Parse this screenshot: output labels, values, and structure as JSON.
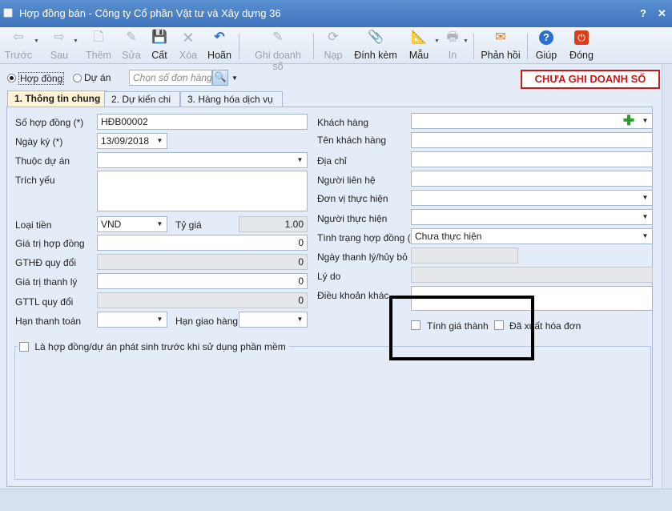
{
  "window": {
    "title": "Hợp đồng bán - Công ty Cổ phần Vật tư và Xây dựng 36",
    "help": "?",
    "close": "✕"
  },
  "toolbar": [
    {
      "label": "Trước",
      "icon": "arrow-left-icon",
      "glyph": "⇦",
      "enabled": false
    },
    {
      "label": "Sau",
      "icon": "arrow-right-icon",
      "glyph": "⇨",
      "enabled": false
    },
    {
      "label": "Thêm",
      "icon": "new-doc-icon",
      "glyph": "🗋",
      "enabled": false
    },
    {
      "label": "Sửa",
      "icon": "edit-doc-icon",
      "glyph": "✎",
      "enabled": false
    },
    {
      "label": "Cất",
      "icon": "save-icon",
      "glyph": "💾",
      "enabled": true
    },
    {
      "label": "Xóa",
      "icon": "delete-doc-icon",
      "glyph": "🗙",
      "enabled": false
    },
    {
      "label": "Hoãn",
      "icon": "undo-icon",
      "glyph": "↶",
      "enabled": true
    },
    {
      "label": "Ghi doanh số",
      "icon": "pencil-icon",
      "glyph": "✎",
      "enabled": false
    },
    {
      "label": "Nạp",
      "icon": "reload-icon",
      "glyph": "⟳",
      "enabled": false
    },
    {
      "label": "Đính kèm",
      "icon": "paperclip-icon",
      "glyph": "📎",
      "enabled": true
    },
    {
      "label": "Mẫu",
      "icon": "template-icon",
      "glyph": "📐",
      "enabled": true
    },
    {
      "label": "In",
      "icon": "print-icon",
      "glyph": "🖶",
      "enabled": false
    },
    {
      "label": "Phản hồi",
      "icon": "mail-icon",
      "glyph": "✉",
      "enabled": true
    },
    {
      "label": "Giúp",
      "icon": "help-icon",
      "glyph": "?",
      "enabled": true
    },
    {
      "label": "Đóng",
      "icon": "close-icon",
      "glyph": "⏻",
      "enabled": true
    }
  ],
  "mode": {
    "contract": "Hợp đồng",
    "project": "Dự án",
    "search_placeholder": "Chọn số đơn hàng"
  },
  "status_badge": "CHƯA GHI DOANH SỐ",
  "tabs": [
    "1. Thông tin chung",
    "2. Dự kiến chi",
    "3. Hàng hóa dịch vụ"
  ],
  "left": {
    "so_hop_dong": {
      "label": "Số hợp đồng (*)",
      "value": "HĐB00002"
    },
    "ngay_ky": {
      "label": "Ngày ký (*)",
      "value": "13/09/2018"
    },
    "thuoc_du_an": {
      "label": "Thuộc dự án",
      "value": ""
    },
    "trich_yeu": {
      "label": "Trích yếu",
      "value": ""
    },
    "loai_tien": {
      "label": "Loại tiền",
      "value": "VND"
    },
    "ty_gia": {
      "label": "Tỷ giá",
      "value": "1.00"
    },
    "gia_tri_hd": {
      "label": "Giá trị hợp đồng",
      "value": "0"
    },
    "gthd_quy_doi": {
      "label": "GTHĐ quy đổi",
      "value": "0"
    },
    "gia_tri_tl": {
      "label": "Giá trị thanh lý",
      "value": "0"
    },
    "gttl_quy_doi": {
      "label": "GTTL quy đổi",
      "value": "0"
    },
    "han_thanh_toan": {
      "label": "Hạn thanh toán",
      "value": ""
    },
    "han_giao_hang": {
      "label": "Hạn giao hàng",
      "value": ""
    }
  },
  "right": {
    "khach_hang": {
      "label": "Khách hàng",
      "value": ""
    },
    "ten_khach_hang": {
      "label": "Tên khách hàng",
      "value": ""
    },
    "dia_chi": {
      "label": "Địa chỉ",
      "value": ""
    },
    "nguoi_lien_he": {
      "label": "Người liên hệ",
      "value": ""
    },
    "don_vi_thuc_hien": {
      "label": "Đơn vị thực hiện",
      "value": ""
    },
    "nguoi_thuc_hien": {
      "label": "Người thực hiện",
      "value": ""
    },
    "tinh_trang": {
      "label": "Tình trạng hợp đồng (*)",
      "value": "Chưa thực hiện"
    },
    "ngay_thanh_ly": {
      "label": "Ngày thanh lý/hủy bỏ",
      "value": ""
    },
    "ly_do": {
      "label": "Lý do",
      "value": ""
    },
    "dieu_khoan": {
      "label": "Điều khoản khác",
      "value": ""
    }
  },
  "checkboxes": {
    "tinh_gia_thanh": "Tính giá thành",
    "da_xuat_hoa_don": "Đã xuất hóa đơn",
    "phat_sinh_truoc": "Là hợp đồng/dự án phát sinh trước khi sử dụng phần mềm"
  }
}
